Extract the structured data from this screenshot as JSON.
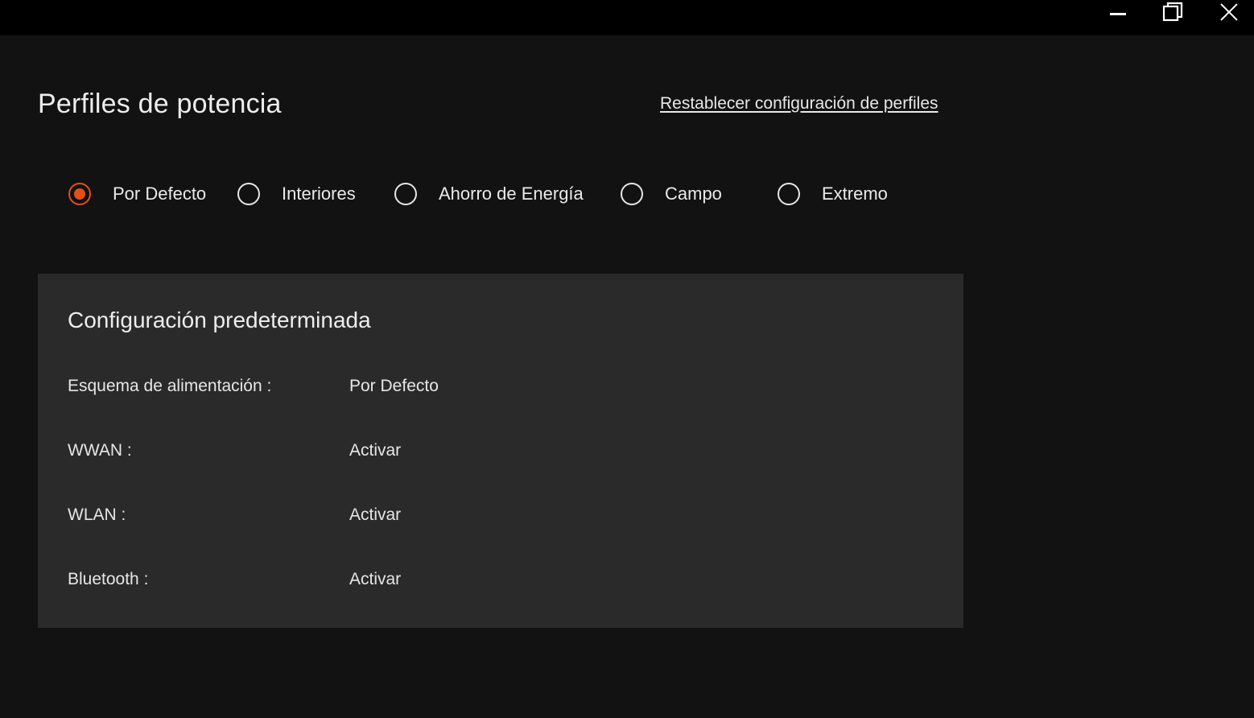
{
  "window": {
    "controls": {
      "minimize_icon": "minimize-icon",
      "maximize_icon": "restore-icon",
      "close_icon": "close-icon"
    }
  },
  "header": {
    "title": "Perfiles de potencia",
    "reset_link": "Restablecer configuración de perfiles"
  },
  "profiles": {
    "selected": "Por Defecto",
    "options": [
      {
        "label": "Por Defecto",
        "checked": true
      },
      {
        "label": "Interiores",
        "checked": false
      },
      {
        "label": "Ahorro de Energía",
        "checked": false
      },
      {
        "label": "Campo",
        "checked": false
      },
      {
        "label": "Extremo",
        "checked": false
      }
    ]
  },
  "settings_panel": {
    "title": "Configuración predeterminada",
    "rows": [
      {
        "label": "Esquema de alimentación :",
        "value": "Por Defecto"
      },
      {
        "label": "WWAN :",
        "value": "Activar"
      },
      {
        "label": "WLAN :",
        "value": "Activar"
      },
      {
        "label": "Bluetooth :",
        "value": "Activar"
      }
    ]
  },
  "colors": {
    "accent": "#e0501a",
    "background": "#121212",
    "titlebar": "#000000",
    "panel": "#2a2a2a",
    "text": "#e8e8e8"
  }
}
